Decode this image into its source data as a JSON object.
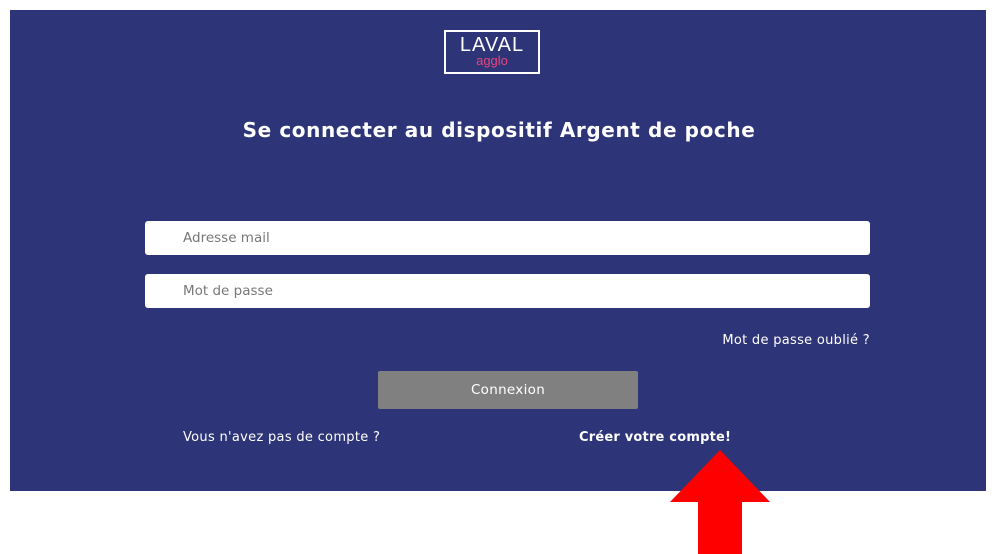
{
  "logo": {
    "top_text": "LAVAL",
    "bottom_text": "agglo"
  },
  "login": {
    "title": "Se connecter au dispositif Argent de poche",
    "email_placeholder": "Adresse mail",
    "password_placeholder": "Mot de passe",
    "forgot_password": "Mot de passe oublié ?",
    "submit_label": "Connexion",
    "no_account_text": "Vous n'avez pas de compte ?",
    "create_account_link": "Créer votre compte!"
  },
  "colors": {
    "panel_background": "#2d3477",
    "button_background": "#808080",
    "arrow": "#ff0000",
    "logo_accent": "#e8467c"
  },
  "annotation": {
    "arrow_icon": "up-arrow-icon"
  }
}
